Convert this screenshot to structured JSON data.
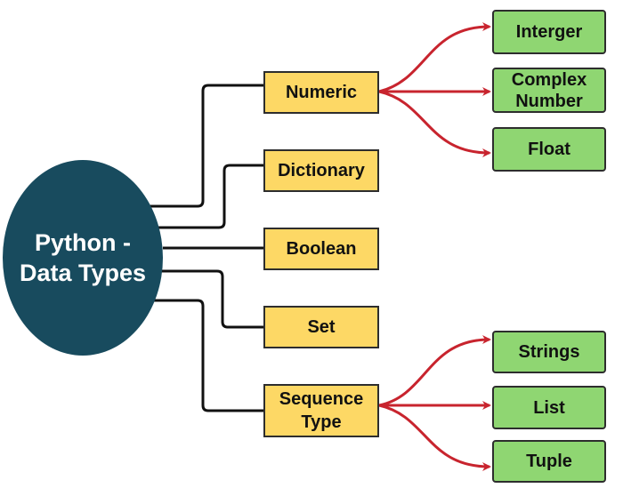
{
  "root": {
    "label_line1": "Python -",
    "label_line2": "Data Types"
  },
  "categories": [
    {
      "label": "Numeric"
    },
    {
      "label": "Dictionary"
    },
    {
      "label": "Boolean"
    },
    {
      "label": "Set"
    },
    {
      "label_line1": "Sequence",
      "label_line2": "Type"
    }
  ],
  "numeric_children": [
    {
      "label": "Interger"
    },
    {
      "label_line1": "Complex",
      "label_line2": "Number"
    },
    {
      "label": "Float"
    }
  ],
  "sequence_children": [
    {
      "label": "Strings"
    },
    {
      "label": "List"
    },
    {
      "label": "Tuple"
    }
  ],
  "colors": {
    "root": "#184b5e",
    "category": "#fdd865",
    "leaf": "#8fd672",
    "connector": "#111111",
    "arrow": "#c8242e"
  }
}
